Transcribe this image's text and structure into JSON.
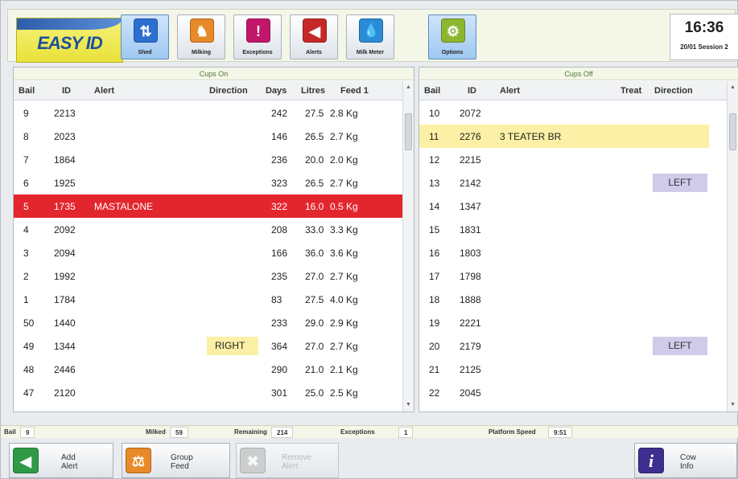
{
  "toolbar": {
    "logo_text": "EASY ID",
    "buttons": [
      {
        "label": "Shed",
        "icon": "shed-sort-icon",
        "color": "#2c6fd1",
        "active": true
      },
      {
        "label": "Milking",
        "icon": "cow-icon",
        "color": "#e8892a",
        "active": false
      },
      {
        "label": "Exceptions",
        "icon": "exclamation-icon",
        "color": "#c2166a",
        "active": false
      },
      {
        "label": "Alerts",
        "icon": "speaker-alert-icon",
        "color": "#c62828",
        "active": false
      },
      {
        "label": "Milk Meter",
        "icon": "milk-drop-icon",
        "color": "#2a8bd6",
        "active": false
      },
      {
        "label": "Options",
        "icon": "gears-icon",
        "color": "#8db72e",
        "active": false
      }
    ],
    "glyphs": {
      "shed": "⇅",
      "milking": "♞",
      "exceptions": "!",
      "alerts": "◀",
      "milk": "💧",
      "options": "⚙"
    }
  },
  "clock": {
    "time": "16:36",
    "date": "20/01 Session 2"
  },
  "cups_on": {
    "title": "Cups On",
    "columns": {
      "bail": "Bail",
      "id": "ID",
      "alert": "Alert",
      "direction": "Direction",
      "days": "Days",
      "litres": "Litres",
      "feed": "Feed 1"
    },
    "rows": [
      {
        "bail": "9",
        "id": "2213",
        "alert": "",
        "direction": "",
        "days": "242",
        "litres": "27.5",
        "feed": "2.8 Kg"
      },
      {
        "bail": "8",
        "id": "2023",
        "alert": "",
        "direction": "",
        "days": "146",
        "litres": "26.5",
        "feed": "2.7 Kg"
      },
      {
        "bail": "7",
        "id": "1864",
        "alert": "",
        "direction": "",
        "days": "236",
        "litres": "20.0",
        "feed": "2.0 Kg"
      },
      {
        "bail": "6",
        "id": "1925",
        "alert": "",
        "direction": "",
        "days": "323",
        "litres": "26.5",
        "feed": "2.7 Kg"
      },
      {
        "bail": "5",
        "id": "1735",
        "alert": "MASTALONE",
        "direction": "",
        "days": "322",
        "litres": "16.0",
        "feed": "0.5 Kg"
      },
      {
        "bail": "4",
        "id": "2092",
        "alert": "",
        "direction": "",
        "days": "208",
        "litres": "33.0",
        "feed": "3.3 Kg"
      },
      {
        "bail": "3",
        "id": "2094",
        "alert": "",
        "direction": "",
        "days": "166",
        "litres": "36.0",
        "feed": "3.6 Kg"
      },
      {
        "bail": "2",
        "id": "1992",
        "alert": "",
        "direction": "",
        "days": "235",
        "litres": "27.0",
        "feed": "2.7 Kg"
      },
      {
        "bail": "1",
        "id": "1784",
        "alert": "",
        "direction": "",
        "days": "83",
        "litres": "27.5",
        "feed": "4.0 Kg"
      },
      {
        "bail": "50",
        "id": "1440",
        "alert": "",
        "direction": "",
        "days": "233",
        "litres": "29.0",
        "feed": "2.9 Kg"
      },
      {
        "bail": "49",
        "id": "1344",
        "alert": "",
        "direction": "RIGHT",
        "days": "364",
        "litres": "27.0",
        "feed": "2.7 Kg"
      },
      {
        "bail": "48",
        "id": "2446",
        "alert": "",
        "direction": "",
        "days": "290",
        "litres": "21.0",
        "feed": "2.1 Kg"
      },
      {
        "bail": "47",
        "id": "2120",
        "alert": "",
        "direction": "",
        "days": "301",
        "litres": "25.0",
        "feed": "2.5 Kg"
      }
    ]
  },
  "cups_off": {
    "title": "Cups Off",
    "columns": {
      "bail": "Bail",
      "id": "ID",
      "alert": "Alert",
      "treat": "Treat",
      "direction": "Direction"
    },
    "rows": [
      {
        "bail": "10",
        "id": "2072",
        "alert": "",
        "direction": ""
      },
      {
        "bail": "11",
        "id": "2276",
        "alert": "3 TEATER BR",
        "direction": ""
      },
      {
        "bail": "12",
        "id": "2215",
        "alert": "",
        "direction": ""
      },
      {
        "bail": "13",
        "id": "2142",
        "alert": "",
        "direction": "LEFT"
      },
      {
        "bail": "14",
        "id": "1347",
        "alert": "",
        "direction": ""
      },
      {
        "bail": "15",
        "id": "1831",
        "alert": "",
        "direction": ""
      },
      {
        "bail": "16",
        "id": "1803",
        "alert": "",
        "direction": ""
      },
      {
        "bail": "17",
        "id": "1798",
        "alert": "",
        "direction": ""
      },
      {
        "bail": "18",
        "id": "1888",
        "alert": "",
        "direction": ""
      },
      {
        "bail": "19",
        "id": "2221",
        "alert": "",
        "direction": ""
      },
      {
        "bail": "20",
        "id": "2179",
        "alert": "",
        "direction": "LEFT"
      },
      {
        "bail": "21",
        "id": "2125",
        "alert": "",
        "direction": ""
      },
      {
        "bail": "22",
        "id": "2045",
        "alert": "",
        "direction": ""
      }
    ]
  },
  "status": {
    "bail_label": "Bail",
    "bail_value": "9",
    "milked_label": "Milked",
    "milked_value": "59",
    "remaining_label": "Remaining",
    "remaining_value": "214",
    "exceptions_label": "Exceptions",
    "exceptions_value": "1",
    "speed_label": "Platform Speed",
    "speed_value": "9:51"
  },
  "actions": {
    "add_alert": "Add\nAlert",
    "group_feed": "Group\nFeed",
    "remove_alert": "Remove\nAlert",
    "cow_info": "Cow\nInfo",
    "glyphs": {
      "add_alert": "◀",
      "group_feed": "⚖",
      "remove_alert": "✖",
      "cow_info": "i"
    }
  },
  "colors": {
    "alert_row": "#e3262e",
    "highlight_row": "#fbf0a5",
    "left_chip": "#cfcbe9",
    "right_chip": "#fbf0a5"
  }
}
